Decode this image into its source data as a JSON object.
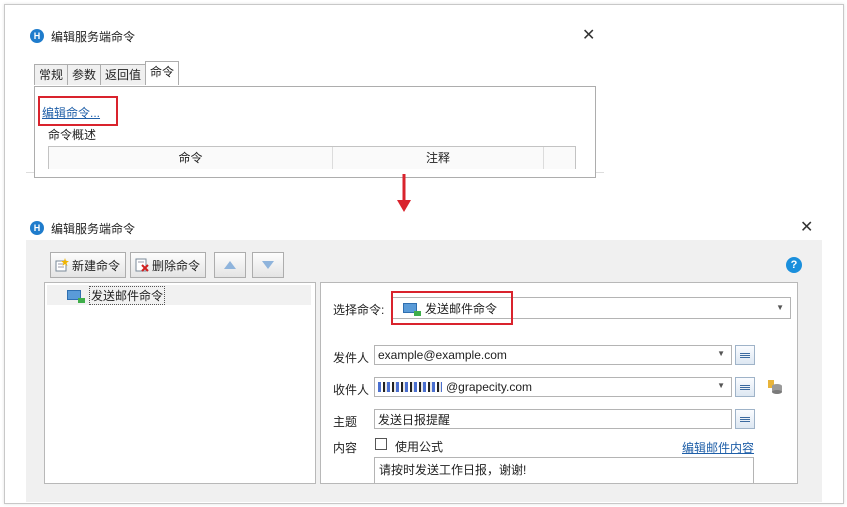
{
  "top_dialog": {
    "title": "编辑服务端命令",
    "tabs": [
      {
        "label": "常规"
      },
      {
        "label": "参数"
      },
      {
        "label": "返回值"
      },
      {
        "label": "命令"
      }
    ],
    "edit_link": "编辑命令...",
    "description_label": "命令概述",
    "grid_headers": [
      "命令",
      "注释"
    ]
  },
  "main_dialog": {
    "title": "编辑服务端命令",
    "toolbar": {
      "new_label": "新建命令",
      "delete_label": "删除命令"
    },
    "tree": {
      "items": [
        {
          "label": "发送邮件命令"
        }
      ]
    },
    "form": {
      "select_command_label": "选择命令:",
      "select_command_value": "发送邮件命令",
      "sender_label": "发件人",
      "sender_value": "example@example.com",
      "recipient_label": "收件人",
      "recipient_value": "@grapecity.com",
      "subject_label": "主题",
      "subject_value": "发送日报提醒",
      "content_label": "内容",
      "use_formula_label": "使用公式",
      "edit_content_link": "编辑邮件内容",
      "content_value": "请按时发送工作日报，谢谢!"
    }
  },
  "colors": {
    "highlight_red": "#d9232d",
    "link_blue": "#1f5fa8",
    "help_blue": "#1a8fdc"
  },
  "icons": [
    "app-icon",
    "close-icon",
    "new-command-icon",
    "delete-command-icon",
    "move-up-icon",
    "move-down-icon",
    "mail-command-icon",
    "help-icon",
    "dropdown-arrow-icon",
    "formula-settings-icon",
    "database-icon",
    "down-arrow-icon"
  ]
}
